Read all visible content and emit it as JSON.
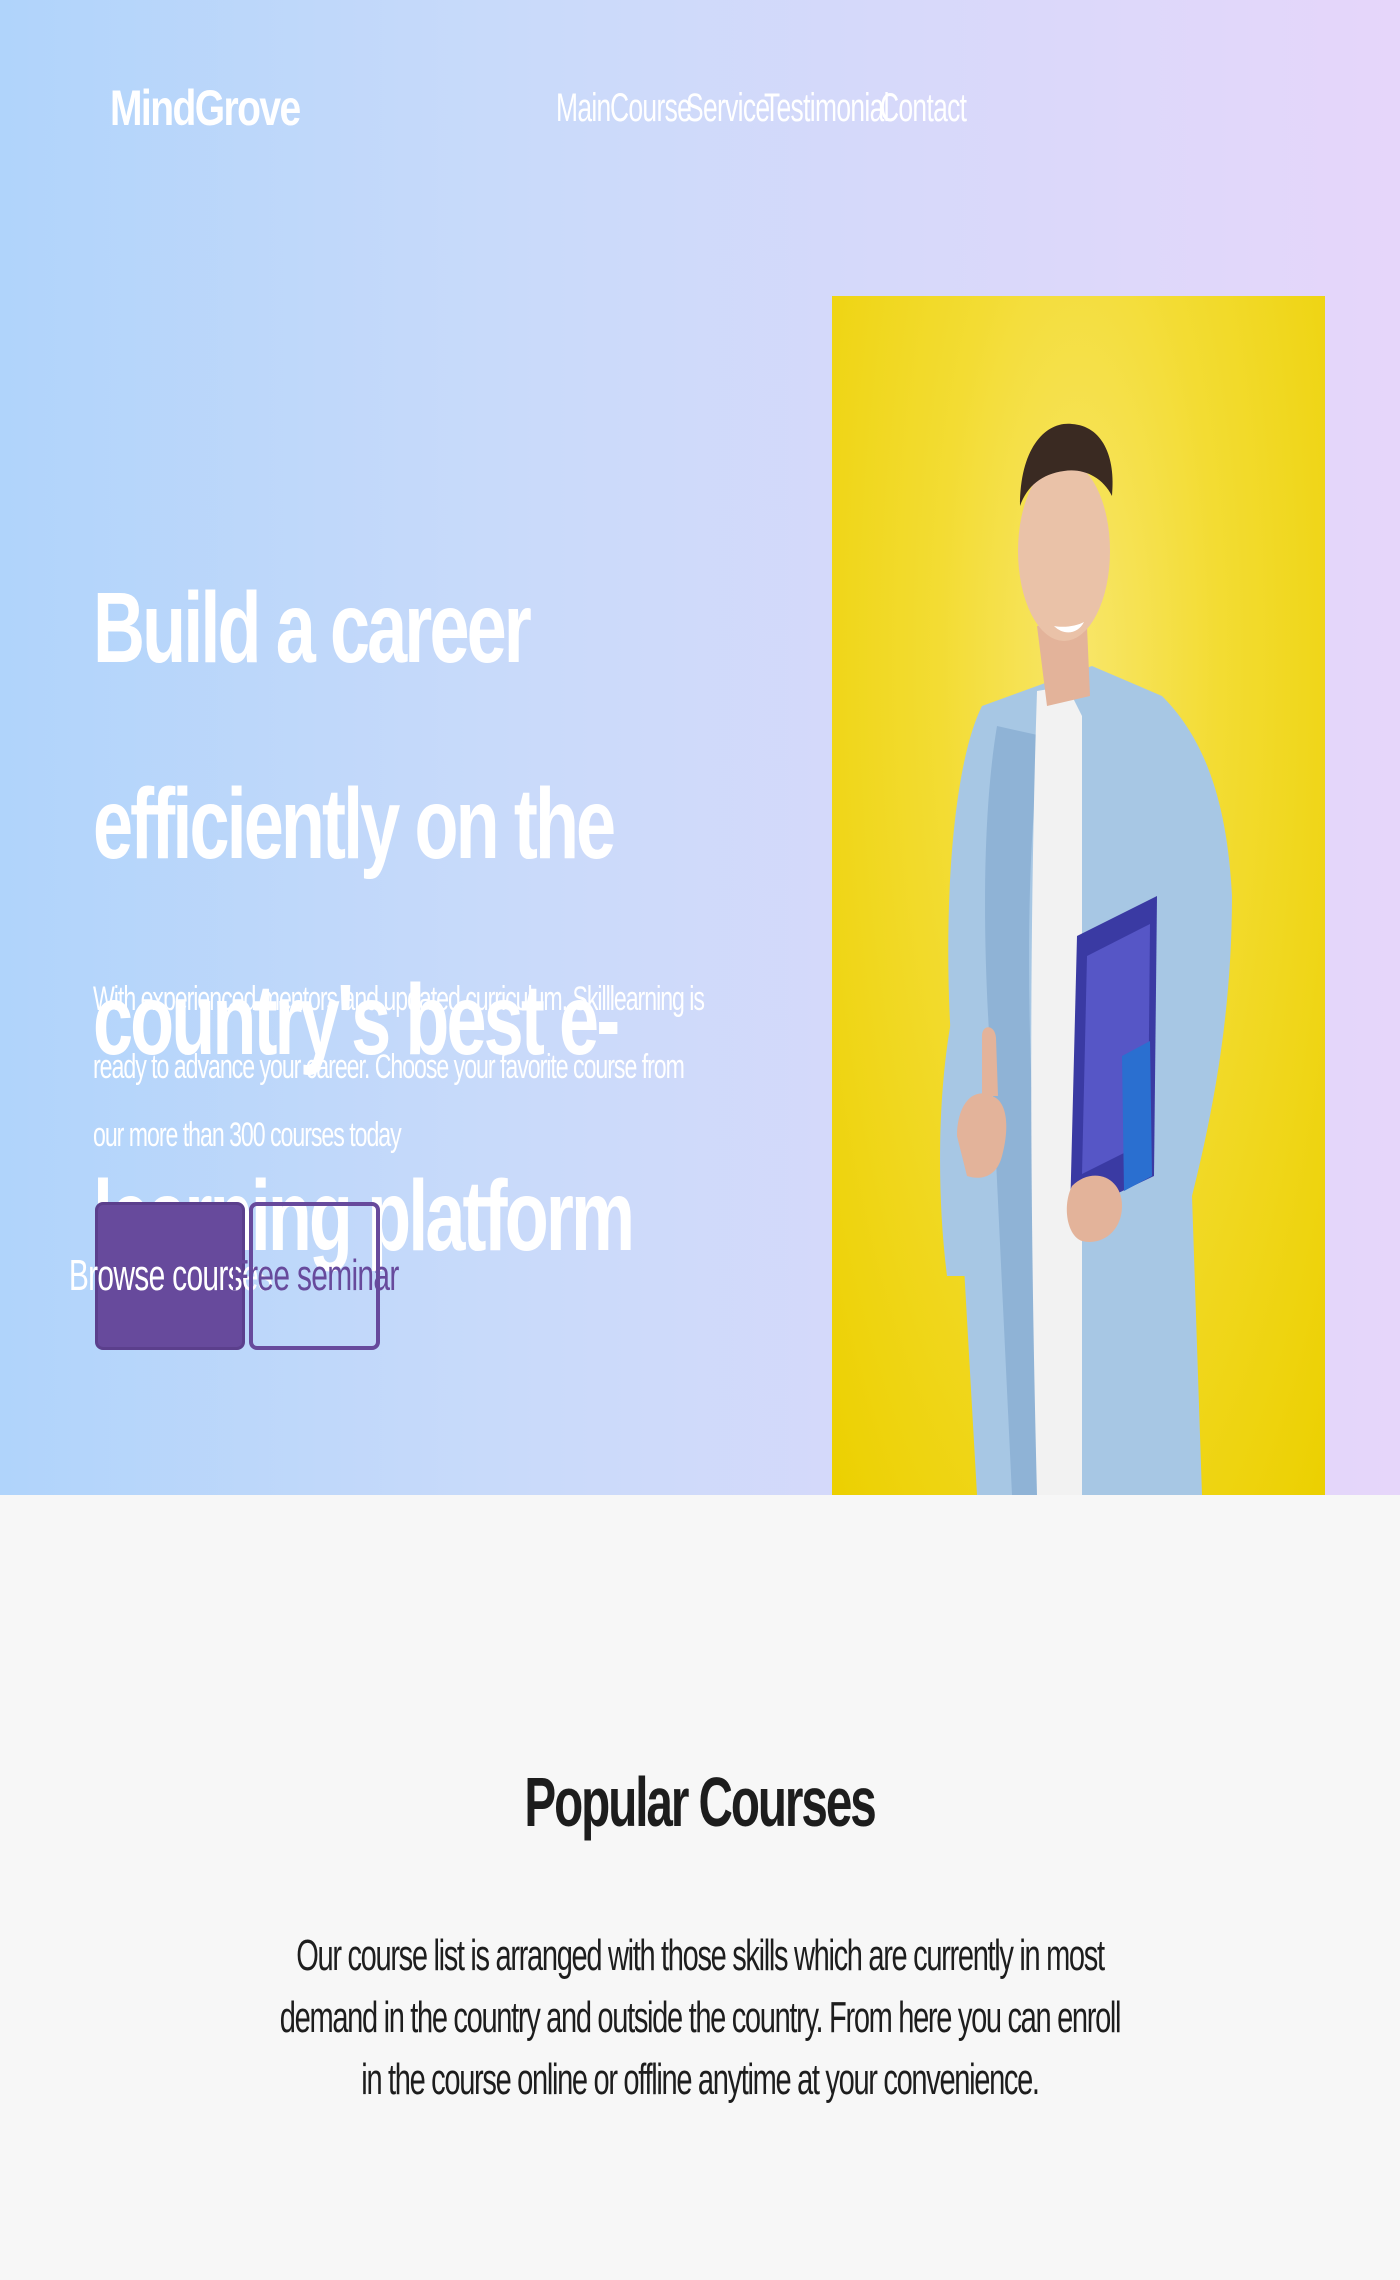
{
  "brand": {
    "name": "MindGrove"
  },
  "nav": {
    "items": [
      "Main",
      "Course",
      "Service",
      "Testimonial",
      "Contact"
    ]
  },
  "hero": {
    "headline": "Build a career efficiently on the country's best e-learning platform",
    "subtext": "With experienced mentors and updated curriculum, Skilllearning is ready to advance your career. Choose your favorite course from our more than 300 courses today",
    "primary_button": "Browse courses",
    "secondary_button": "Free seminar",
    "image_alt": "Smiling student holding blue notebooks, giving a thumbs up on yellow background"
  },
  "popular": {
    "title": "Popular Courses",
    "description": "Our course list is arranged with those skills which are currently in most demand in the country and outside the country. From here you can enroll in the course online or offline anytime at your convenience."
  },
  "colors": {
    "accent": "#674a9c",
    "hero_bg_left": "#b0d4fb",
    "hero_bg_right": "#e6d6fa",
    "photo_bg": "#ecd000",
    "page_bg": "#f7f7f7",
    "text_dark": "#1d1d1d"
  }
}
